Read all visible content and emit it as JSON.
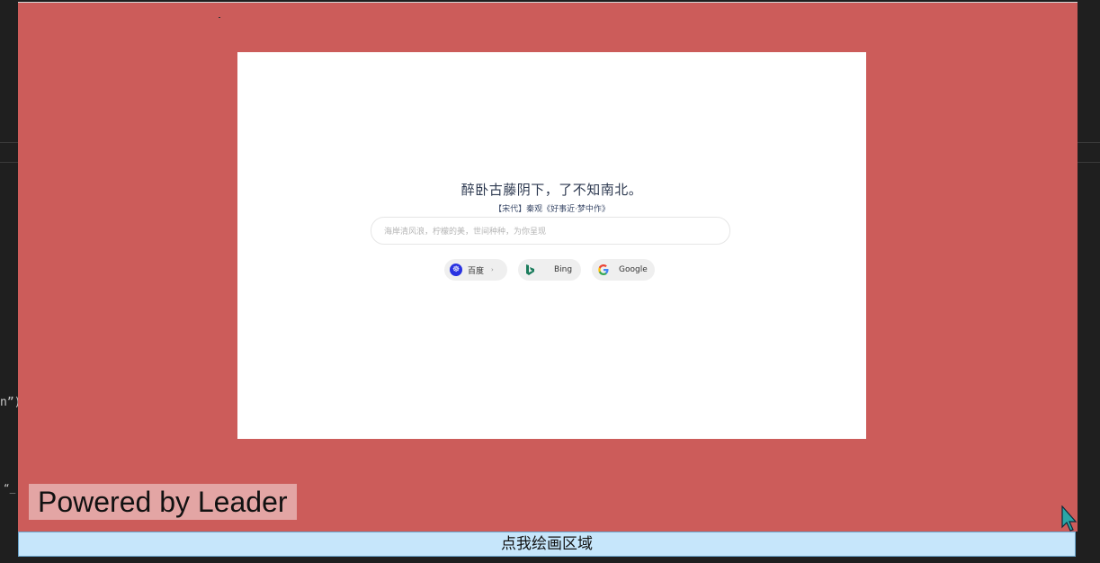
{
  "editor": {
    "fragment_1": "n”)",
    "fragment_2": "“_"
  },
  "stage": {
    "quote": "醉卧古藤阴下，了不知南北。",
    "source": "【宋代】秦观《好事近·梦中作》",
    "search_placeholder": "海岸清风浪，柠檬的美，世间种种，为你呈现",
    "engines": [
      {
        "label": "百度",
        "icon": "baidu-icon",
        "color": "#2932e1",
        "has_caret": true,
        "caret": "›"
      },
      {
        "label": "Bing",
        "icon": "bing-icon",
        "color": "#1b7c5c"
      },
      {
        "label": "Google",
        "icon": "google-icon"
      }
    ]
  },
  "overlay": {
    "background": "#cc5c5a",
    "watermark": "Powered by Leader"
  },
  "draw_button": {
    "label": "点我绘画区域",
    "background": "#c6e6fb"
  }
}
